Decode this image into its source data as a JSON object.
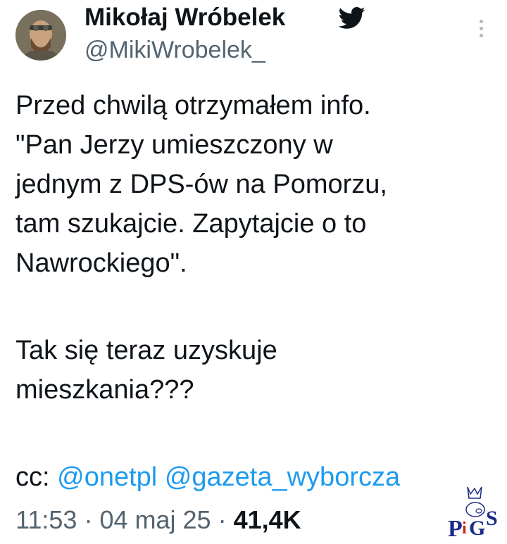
{
  "author": {
    "name": "Mikołaj Wróbelek",
    "handle": "@MikiWrobelek_",
    "avatar_icon": "user-avatar",
    "bird_icon": "twitter-bird-icon"
  },
  "tweet": {
    "lines": [
      "Przed chwilą otrzymałem info.",
      "\"Pan Jerzy umieszczony w",
      "jednym z DPS-ów na Pomorzu,",
      "tam szukajcie. Zapytajcie o to",
      "Nawrockiego\".",
      "Tak się teraz uzyskuje",
      "mieszkania???"
    ],
    "cc_label": "cc:",
    "mentions": [
      "@onetpl",
      "@gazeta_wyborcza"
    ]
  },
  "meta": {
    "time": "11:53",
    "separator": "·",
    "date": "04 maj 25",
    "views": "41,4K"
  },
  "watermark": {
    "text": "PiGS",
    "icon": "pigs-crown-logo"
  },
  "colors": {
    "text": "#0f1419",
    "secondary": "#536471",
    "link": "#1d9bf0",
    "bird": "#1d9bf0"
  }
}
